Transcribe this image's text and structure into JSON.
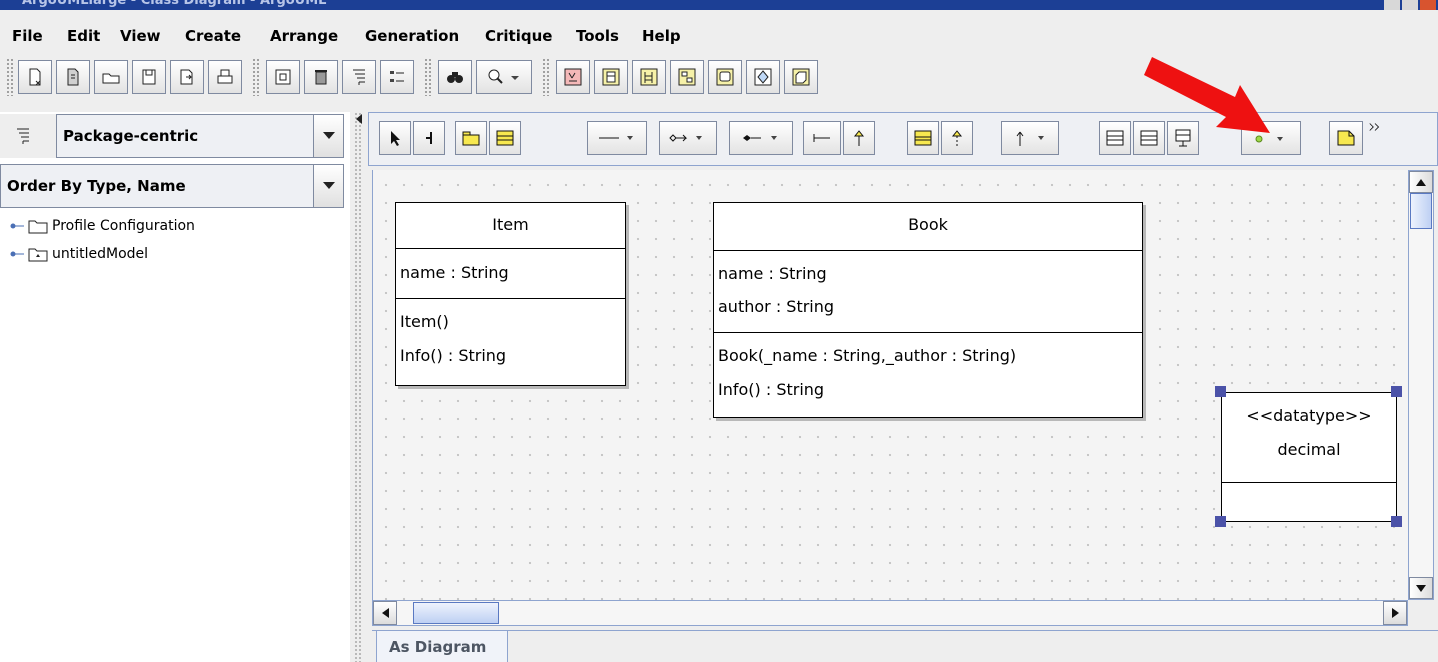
{
  "window": {
    "title": "ArgoUMLlarge - Class Diagram - ArgoUML",
    "accent": "#1c3f95"
  },
  "menubar": {
    "items": [
      "File",
      "Edit",
      "View",
      "Create",
      "Arrange",
      "Generation",
      "Critique",
      "Tools",
      "Help"
    ]
  },
  "main_toolbar": {
    "icons": [
      "new-project-icon",
      "new-from-template-icon",
      "open-project-icon",
      "save-project-icon",
      "save-as-icon",
      "print-icon",
      "project-properties-icon",
      "delete-icon",
      "navigate-tree-icon",
      "settings-icon",
      "find-icon",
      "zoom-icon",
      "new-use-case-diagram-icon",
      "new-class-diagram-icon",
      "new-sequence-diagram-icon",
      "new-collaboration-diagram-icon",
      "new-statechart-diagram-icon",
      "new-activity-diagram-icon",
      "new-deployment-diagram-icon"
    ]
  },
  "explorer": {
    "perspective": "Package-centric",
    "order": "Order By Type, Name",
    "tree": [
      "Profile Configuration",
      "untitledModel"
    ]
  },
  "diagram_toolbar": {
    "icons": [
      "select-icon",
      "broom-icon",
      "new-package-icon",
      "new-class-icon",
      "association-icon",
      "composition-icon",
      "aggregation-icon",
      "dependency-icon",
      "generalization-icon",
      "new-interface-icon",
      "realization-icon",
      "usage-icon",
      "new-enumeration-icon",
      "new-datatype-icon",
      "new-stereotype-icon",
      "new-signal-icon",
      "new-comment-icon",
      "more-icon"
    ]
  },
  "diagram": {
    "classes": [
      {
        "name": "Item",
        "attributes": [
          "name : String"
        ],
        "operations": [
          "Item()",
          "Info() : String"
        ]
      },
      {
        "name": "Book",
        "attributes": [
          "name : String",
          "author : String"
        ],
        "operations": [
          "Book(_name : String,_author : String)",
          "Info() : String"
        ]
      }
    ],
    "datatype": {
      "stereotype": "<<datatype>>",
      "name": "decimal"
    }
  },
  "tabs": {
    "active": "As Diagram"
  },
  "annotation": {
    "arrow_color": "#ee1111"
  }
}
